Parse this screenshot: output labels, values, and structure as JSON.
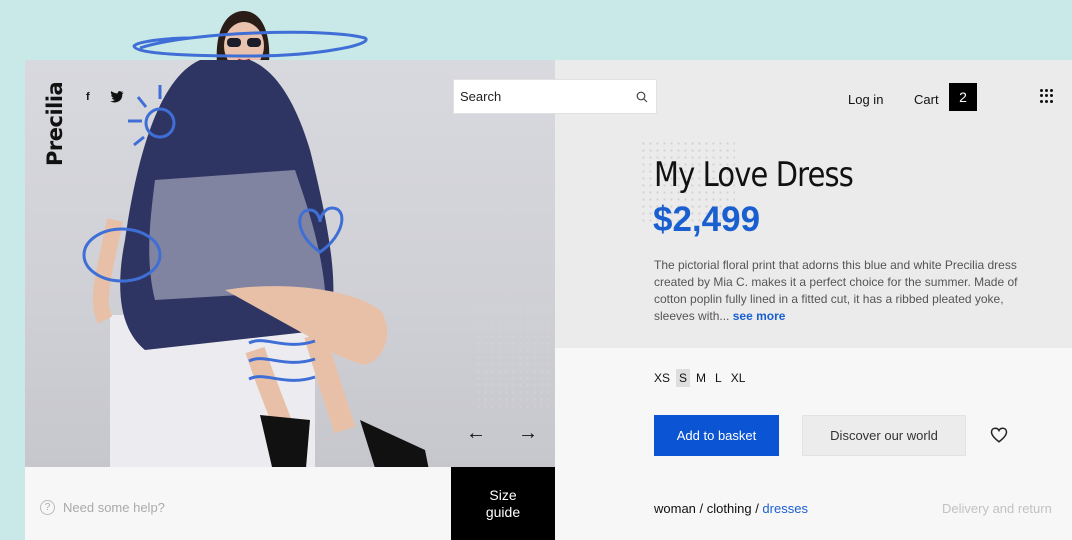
{
  "brand": {
    "name": "Precilia"
  },
  "social": {
    "facebook": "f",
    "twitter": "twitter-icon"
  },
  "search": {
    "placeholder": "Search"
  },
  "header": {
    "login": "Log in",
    "cart_label": "Cart",
    "cart_count": "2"
  },
  "product": {
    "title": "My Love Dress",
    "price": "$2,499",
    "description": "The pictorial floral print that adorns this blue and white Precilia dress created by Mia C. makes it a perfect choice for the summer. Made of cotton poplin fully lined in a fitted cut, it has a ribbed pleated yoke, sleeves with...",
    "see_more": "see more",
    "sizes": [
      "XS",
      "S",
      "M",
      "L",
      "XL"
    ],
    "selected_size": "S"
  },
  "actions": {
    "add_to_basket": "Add to basket",
    "discover": "Discover our world"
  },
  "nav": {
    "prev": "←",
    "next": "→"
  },
  "help": {
    "text": "Need some help?",
    "icon_glyph": "?"
  },
  "size_guide": {
    "line1": "Size",
    "line2": "guide"
  },
  "breadcrumb": {
    "part1": "woman",
    "sep": " / ",
    "part2": "clothing",
    "current": "dresses"
  },
  "delivery": {
    "text": "Delivery and return"
  },
  "colors": {
    "accent": "#1a5fd0",
    "button": "#0b55d4",
    "background": "#c9e8e8",
    "doodle": "#3f6fd6"
  }
}
